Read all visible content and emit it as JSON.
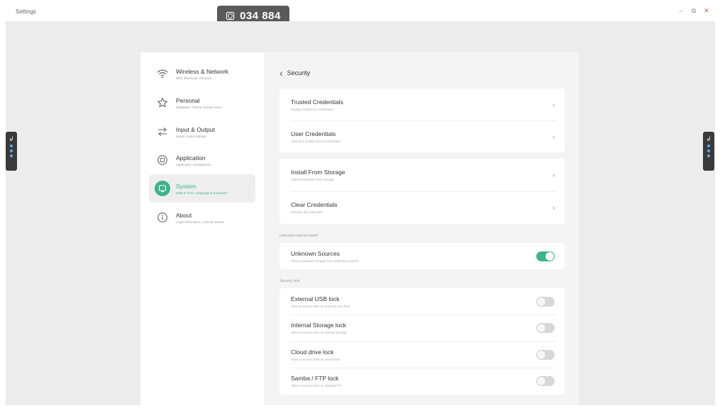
{
  "window": {
    "title": "Settings",
    "minimize": "–",
    "restore": "⧉",
    "close": "✕"
  },
  "code_badge": {
    "code": "034 884",
    "icon": "shield-icon"
  },
  "side_tabs": {
    "back_glyph": "↲"
  },
  "nav": {
    "items": [
      {
        "label": "Wireless & Network",
        "sub": "WiFi, Bluetooth, Ethernet",
        "icon": "wifi-icon"
      },
      {
        "label": "Personal",
        "sub": "Wallpaper, Theme, Screen saver",
        "icon": "star-icon"
      },
      {
        "label": "Input & Output",
        "sub": "Inputs, Audio settings",
        "icon": "arrows-icon"
      },
      {
        "label": "Application",
        "sub": "Application management",
        "icon": "app-icon"
      },
      {
        "label": "System",
        "sub": "Date & Time, Language & Keyboard",
        "icon": "system-icon"
      },
      {
        "label": "About",
        "sub": "Legal information, Android version",
        "icon": "info-icon"
      }
    ],
    "active_index": 4,
    "accent": "#3bb58a"
  },
  "content": {
    "back_glyph": "‹",
    "title": "Security",
    "credentials": [
      {
        "title": "Trusted Credentials",
        "sub": "Display trusted CA certificates"
      },
      {
        "title": "User Credentials",
        "sub": "View and modify stored certificates"
      }
    ],
    "storage": [
      {
        "title": "Install From Storage",
        "sub": "Install certificates from storage"
      },
      {
        "title": "Clear Credentials",
        "sub": "Remove all certificates"
      }
    ],
    "unknown_section_label": "Unknown sources install",
    "unknown_sources": {
      "title": "Unknown Sources",
      "sub": "Allow installation of apps from unknown sources",
      "on": true
    },
    "lock_section_label": "Security lock",
    "locks": [
      {
        "title": "External USB lock",
        "sub": "Allow to access files on external usb drive",
        "on": false
      },
      {
        "title": "Internal Storage lock",
        "sub": "Allow to access files on internal storage",
        "on": false
      },
      {
        "title": "Cloud drive lock",
        "sub": "Allow to access files on cloud drive",
        "on": false
      },
      {
        "title": "Samba / FTP lock",
        "sub": "Allow to access files on Samba/FTP",
        "on": false
      }
    ],
    "chevron": "›"
  }
}
